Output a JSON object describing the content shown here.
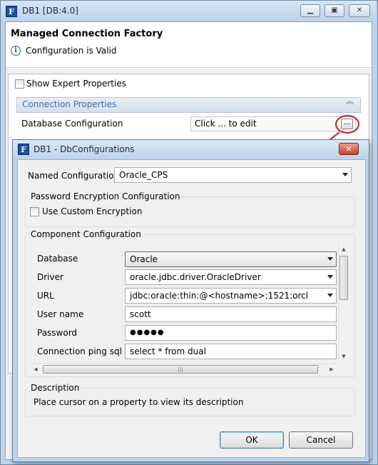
{
  "outer_window": {
    "title": "DB1 [DB:4.0]",
    "app_logo": "F",
    "header_title": "Managed Connection Factory",
    "status_text": "Configuration is Valid",
    "show_expert_label": "Show Expert Properties",
    "section_title": "Connection Properties",
    "db_config_label": "Database Configuration",
    "db_config_value": "Click ... to edit",
    "ellipsis_label": "..."
  },
  "dialog": {
    "title": "DB1 - DbConfigurations",
    "app_logo": "F",
    "named_config_label": "Named Configuration",
    "named_config_value": "Oracle_CPS",
    "password_group_title": "Password Encryption Configuration",
    "custom_encryption_label": "Use Custom Encryption",
    "component_group_title": "Component Configuration",
    "fields": [
      {
        "label": "Database",
        "value": "Oracle",
        "kind": "select"
      },
      {
        "label": "Driver",
        "value": "oracle.jdbc.driver.OracleDriver",
        "kind": "combo"
      },
      {
        "label": "URL",
        "value": "jdbc:oracle:thin:@<hostname>:1521:orcl",
        "kind": "combo"
      },
      {
        "label": "User name",
        "value": "scott",
        "kind": "text"
      },
      {
        "label": "Password",
        "value": "●●●●●",
        "kind": "password"
      },
      {
        "label": "Connection ping sql",
        "value": "select * from dual",
        "kind": "text"
      }
    ],
    "description_title": "Description",
    "description_text": "Place cursor on a property to view its description",
    "ok_label": "OK",
    "cancel_label": "Cancel"
  },
  "colors": {
    "chrome": "#bcd3ea",
    "section_text": "#3a6fb0",
    "callout": "#c0202a"
  },
  "icons": [
    "info-icon",
    "collapse-chevron-icon",
    "minimize-icon",
    "maximize-icon",
    "close-icon",
    "callout-arrow"
  ]
}
